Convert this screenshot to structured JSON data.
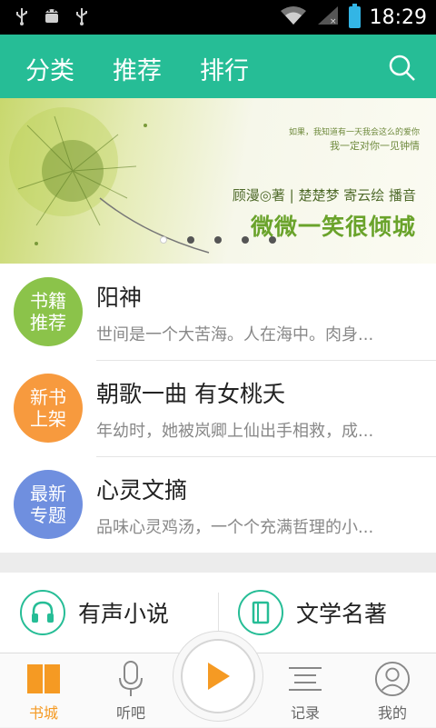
{
  "status_bar": {
    "time": "18:29",
    "icons": [
      "usb-icon",
      "android-debug-icon",
      "usb-icon",
      "wifi-icon",
      "signal-icon",
      "battery-icon"
    ]
  },
  "header": {
    "tabs": [
      {
        "label": "分类",
        "active": true
      },
      {
        "label": "推荐",
        "active": false
      },
      {
        "label": "排行",
        "active": false
      }
    ],
    "search_icon": "search-icon",
    "accent_color": "#26bd96"
  },
  "banner": {
    "tagline_line1": "如果，我知道有一天我会这么的爱你",
    "tagline_line2": "我一定对你一见钟情",
    "author_line": "顾漫◎著 | 楚楚梦 寄云绘 播音",
    "title": "微微一笑很倾城",
    "pager": {
      "count": 5,
      "active_index": 0
    }
  },
  "featured_list": [
    {
      "badge": "书籍推荐",
      "badge_color": "#8bc34a",
      "title": "阳神",
      "desc": "世间是一个大苦海。人在海中。肉身..."
    },
    {
      "badge": "新书上架",
      "badge_color": "#f79a3e",
      "title": "朝歌一曲 有女桃夭",
      "desc": "年幼时，她被岚卿上仙出手相救，成..."
    },
    {
      "badge": "最新专题",
      "badge_color": "#6f8fdf",
      "title": "心灵文摘",
      "desc": "品味心灵鸡汤，一个个充满哲理的小..."
    }
  ],
  "categories": [
    {
      "label": "有声小说",
      "icon": "headphones-icon"
    },
    {
      "label": "文学名著",
      "icon": "book-icon"
    }
  ],
  "bottom_nav": [
    {
      "label": "书城",
      "icon": "bookshelf-icon",
      "active": true
    },
    {
      "label": "听吧",
      "icon": "microphone-icon",
      "active": false
    },
    {
      "label": "记录",
      "icon": "list-icon",
      "active": false
    },
    {
      "label": "我的",
      "icon": "user-icon",
      "active": false
    }
  ],
  "play_button": {
    "icon": "play-icon",
    "color": "#f59a23"
  }
}
